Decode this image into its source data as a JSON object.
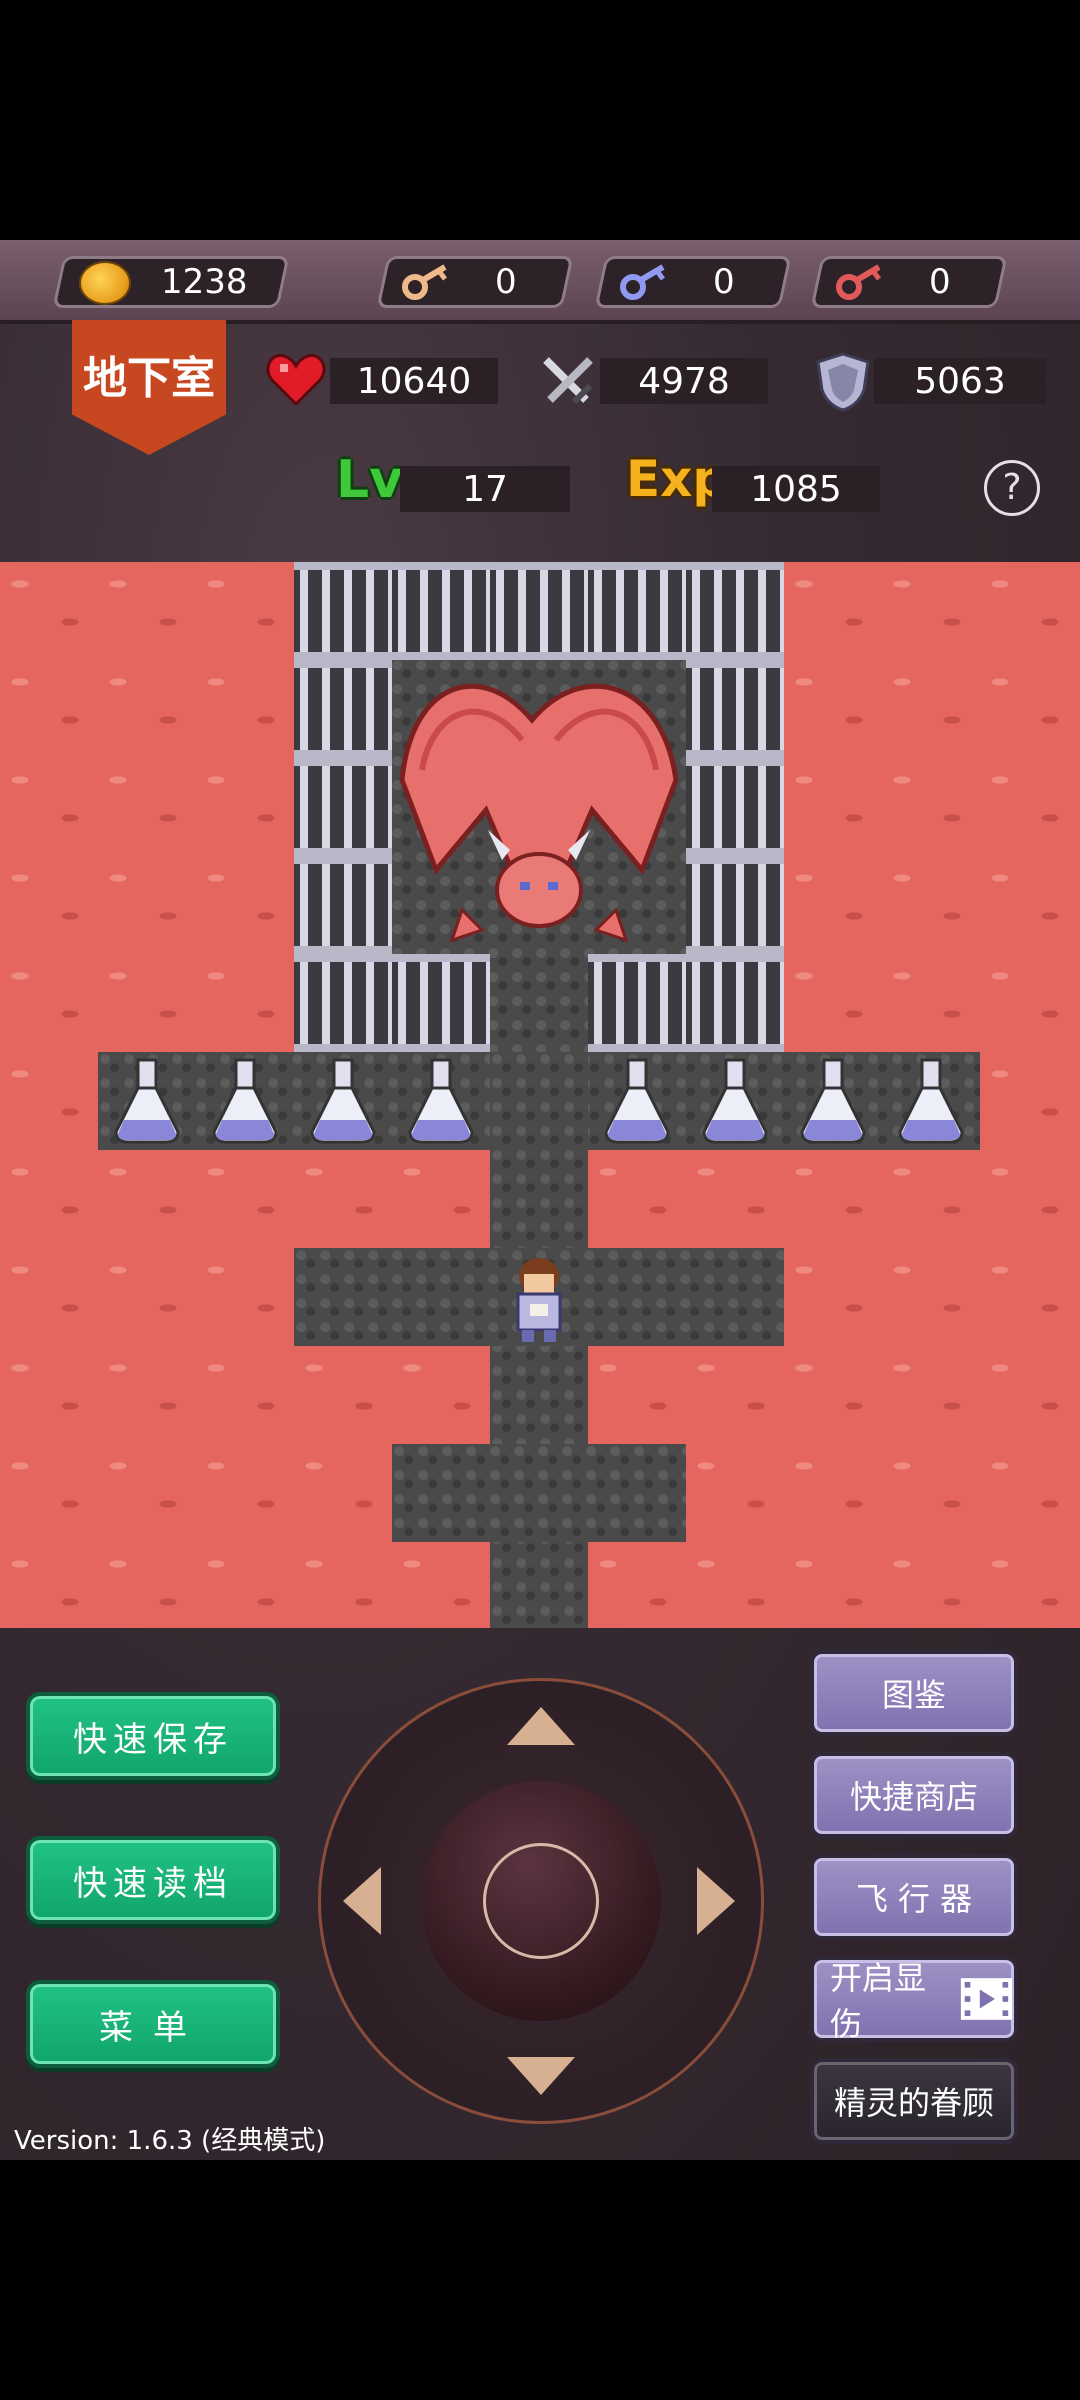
{
  "resources": {
    "gold": "1238",
    "yellow_keys": "0",
    "blue_keys": "0",
    "red_keys": "0"
  },
  "location": "地下室",
  "stats": {
    "hp": "10640",
    "attack": "4978",
    "defense": "5063",
    "level_label": "Lv",
    "level": "17",
    "exp_label": "Exp",
    "exp": "1085"
  },
  "help_icon": "?",
  "map": {
    "floor_tiles": [
      "lava",
      "stone-floor",
      "iron-bars"
    ],
    "monster": "red-dragon",
    "items": [
      "blue-potion",
      "blue-potion",
      "blue-potion",
      "blue-potion",
      "blue-potion",
      "blue-potion",
      "blue-potion",
      "blue-potion"
    ],
    "hero": "brave"
  },
  "buttons": {
    "quick_save": "快速保存",
    "quick_load": "快速读档",
    "menu": "菜单",
    "encyclopedia": "图鉴",
    "quick_shop": "快捷商店",
    "flyer": "飞 行 器",
    "show_damage": "开启显伤",
    "spirit_favor": "精灵的眷顾"
  },
  "version": "Version: 1.6.3 (经典模式)",
  "colors": {
    "lava": "#e5665f",
    "stone": "#4a4a4a",
    "green_button": "#11a56a",
    "purple_button": "#7f71ae",
    "banner": "#c74720"
  }
}
